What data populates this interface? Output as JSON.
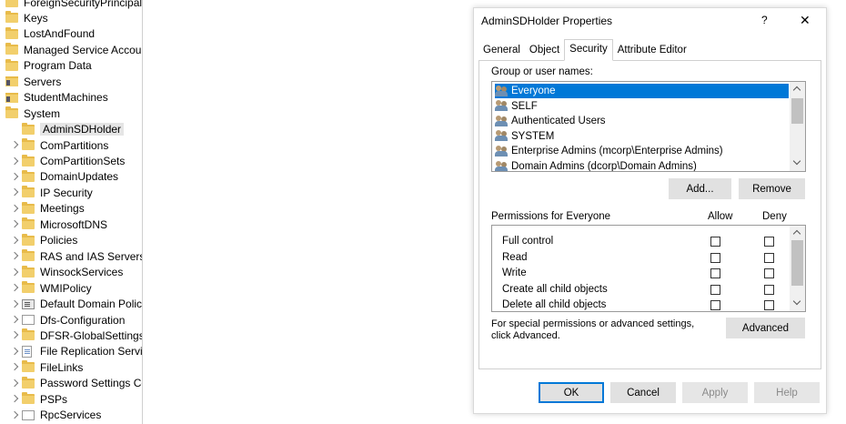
{
  "tree": {
    "items": [
      {
        "label": "ForeignSecurityPrincipals",
        "icon": "folder-icon",
        "chevron": false
      },
      {
        "label": "Keys",
        "icon": "folder-icon",
        "chevron": false
      },
      {
        "label": "LostAndFound",
        "icon": "folder-icon",
        "chevron": false
      },
      {
        "label": "Managed Service Account",
        "icon": "folder-icon",
        "chevron": false
      },
      {
        "label": "Program Data",
        "icon": "folder-icon",
        "chevron": false
      },
      {
        "label": "Servers",
        "icon": "ou-icon",
        "chevron": false
      },
      {
        "label": "StudentMachines",
        "icon": "ou-icon",
        "chevron": false
      },
      {
        "label": "System",
        "icon": "folder-icon",
        "chevron": false
      },
      {
        "label": "AdminSDHolder",
        "icon": "folder-icon",
        "chevron": false,
        "selected": true
      },
      {
        "label": "ComPartitions",
        "icon": "folder-icon",
        "chevron": true
      },
      {
        "label": "ComPartitionSets",
        "icon": "folder-icon",
        "chevron": true
      },
      {
        "label": "DomainUpdates",
        "icon": "folder-icon",
        "chevron": true
      },
      {
        "label": "IP Security",
        "icon": "folder-icon",
        "chevron": true
      },
      {
        "label": "Meetings",
        "icon": "folder-icon",
        "chevron": true
      },
      {
        "label": "MicrosoftDNS",
        "icon": "folder-icon",
        "chevron": true
      },
      {
        "label": "Policies",
        "icon": "folder-icon",
        "chevron": true
      },
      {
        "label": "RAS and IAS Servers A",
        "icon": "folder-icon",
        "chevron": true
      },
      {
        "label": "WinsockServices",
        "icon": "folder-icon",
        "chevron": true
      },
      {
        "label": "WMIPolicy",
        "icon": "folder-icon",
        "chevron": true
      },
      {
        "label": "Default Domain Policy",
        "icon": "gpo-icon",
        "chevron": true
      },
      {
        "label": "Dfs-Configuration",
        "icon": "container-icon",
        "chevron": true
      },
      {
        "label": "DFSR-GlobalSettings",
        "icon": "folder-icon",
        "chevron": true
      },
      {
        "label": "File Replication Servic",
        "icon": "file-icon",
        "chevron": true
      },
      {
        "label": "FileLinks",
        "icon": "folder-icon",
        "chevron": true
      },
      {
        "label": "Password Settings Cor",
        "icon": "folder-icon",
        "chevron": true
      },
      {
        "label": "PSPs",
        "icon": "folder-icon",
        "chevron": true
      },
      {
        "label": "RpcServices",
        "icon": "container-icon",
        "chevron": true
      }
    ]
  },
  "dialog": {
    "title": "AdminSDHolder Properties",
    "help": "?",
    "close": "✕",
    "tabs": [
      "General",
      "Object",
      "Security",
      "Attribute Editor"
    ],
    "active_tab": "Security",
    "group_label": "Group or user names:",
    "users": [
      {
        "name": "Everyone",
        "selected": true
      },
      {
        "name": "SELF"
      },
      {
        "name": "Authenticated Users"
      },
      {
        "name": "SYSTEM"
      },
      {
        "name": "Enterprise Admins (mcorp\\Enterprise Admins)"
      },
      {
        "name": "Domain Admins (dcorp\\Domain Admins)"
      }
    ],
    "add_button": "Add...",
    "remove_button": "Remove",
    "permissions_label": "Permissions for Everyone",
    "allow_header": "Allow",
    "deny_header": "Deny",
    "permissions": [
      {
        "name": "Full control",
        "allow": false,
        "deny": false
      },
      {
        "name": "Read",
        "allow": false,
        "deny": false
      },
      {
        "name": "Write",
        "allow": false,
        "deny": false
      },
      {
        "name": "Create all child objects",
        "allow": false,
        "deny": false
      },
      {
        "name": "Delete all child objects",
        "allow": false,
        "deny": false
      }
    ],
    "special_text": "For special permissions or advanced settings, click Advanced.",
    "advanced_button": "Advanced",
    "ok_button": "OK",
    "cancel_button": "Cancel",
    "apply_button": "Apply",
    "help_button": "Help"
  }
}
